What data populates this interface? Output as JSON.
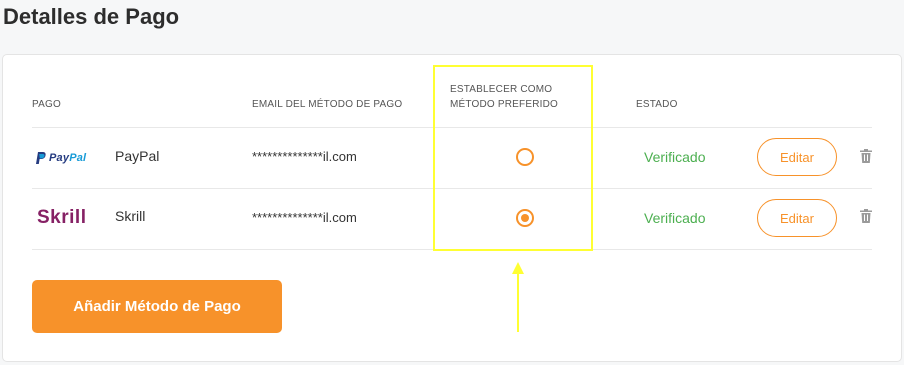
{
  "page": {
    "title": "Detalles de Pago"
  },
  "table": {
    "headers": {
      "payment": "PAGO",
      "email": "EMAIL DEL MÉTODO DE PAGO",
      "preferred_line1": "ESTABLECER COMO",
      "preferred_line2": "MÉTODO PREFERIDO",
      "status": "ESTADO"
    },
    "rows": [
      {
        "logo_text_1": "Pay",
        "logo_text_2": "Pal",
        "name": "PayPal",
        "email": "**************il.com",
        "preferred": false,
        "status": "Verificado",
        "edit_label": "Editar"
      },
      {
        "logo_text": "Skrill",
        "name": "Skrill",
        "email": "**************il.com",
        "preferred": true,
        "status": "Verificado",
        "edit_label": "Editar"
      }
    ]
  },
  "add_button_label": "Añadir Método de Pago",
  "colors": {
    "accent": "#f7922a",
    "verified": "#4caf50",
    "highlight": "#ffff33",
    "paypal_dark": "#253b80",
    "paypal_light": "#179bd7",
    "skrill": "#862165"
  },
  "icons": [
    "paypal-icon",
    "trash-icon",
    "radio-icon",
    "arrow-up-icon"
  ]
}
